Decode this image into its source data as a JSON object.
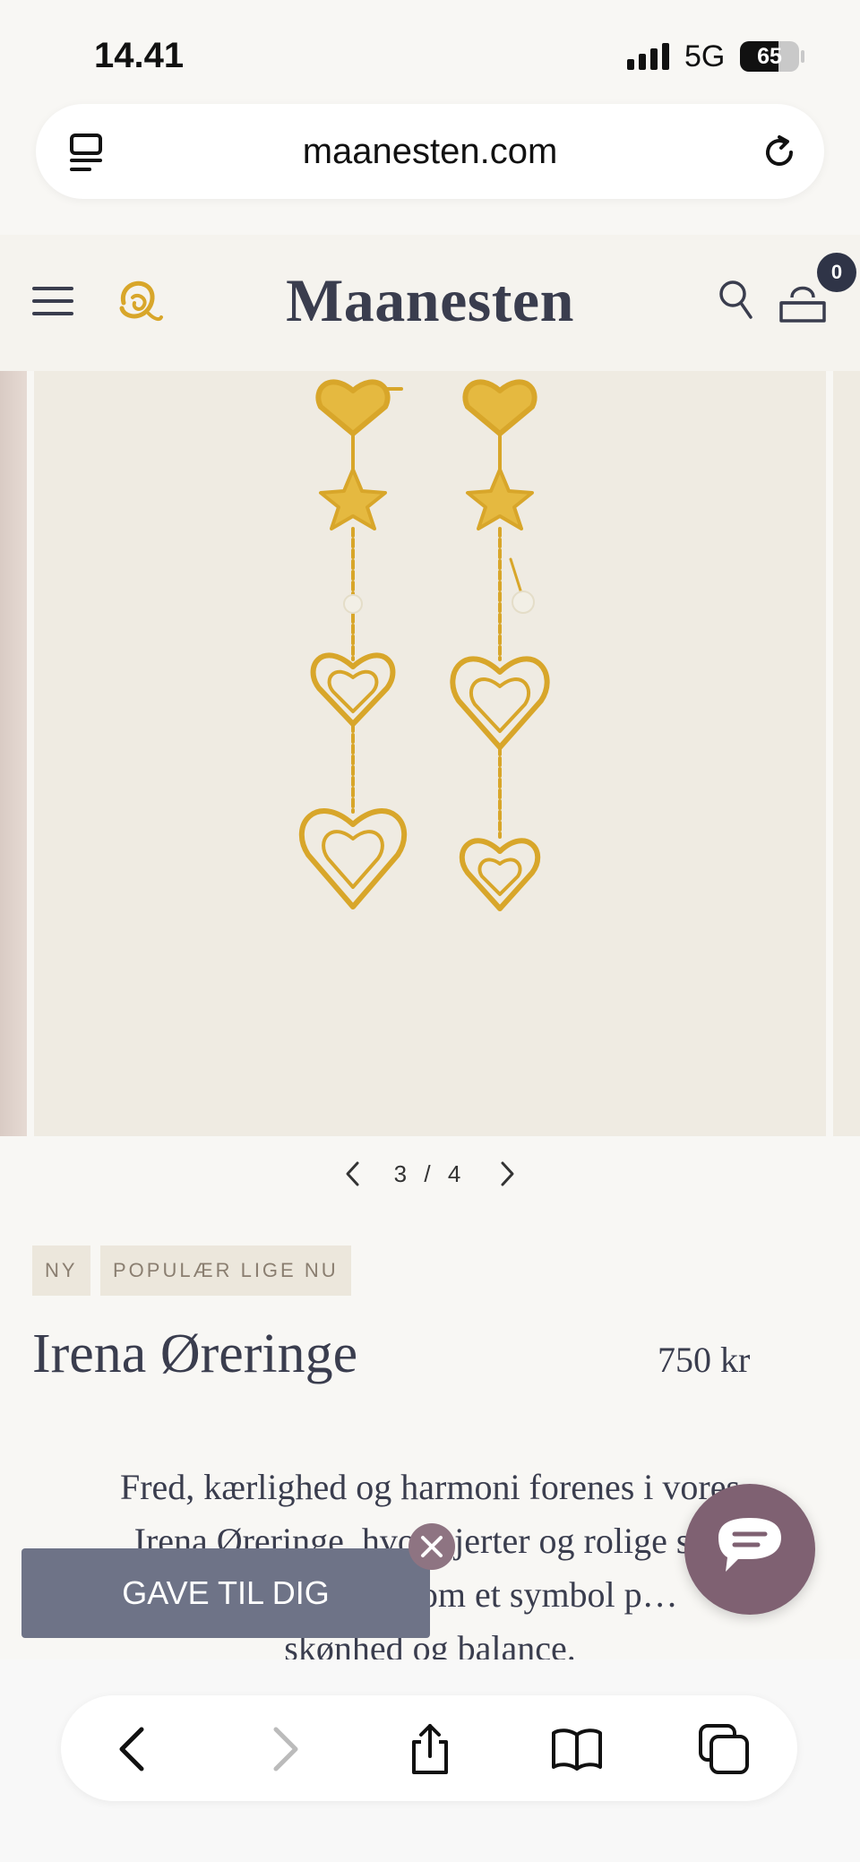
{
  "status_bar": {
    "time": "14.41",
    "network": "5G",
    "battery": "65",
    "battery_level": 0.65
  },
  "browser": {
    "url": "maanesten.com"
  },
  "site": {
    "brand": "Maanesten",
    "cart_count": "0"
  },
  "gallery": {
    "current": "3",
    "separator": "/",
    "total": "4"
  },
  "product": {
    "tags": [
      "NY",
      "POPULÆR LIGE NU"
    ],
    "title": "Irena Øreringe",
    "price": "750 kr",
    "description_lines": [
      "Fred, kærlighed og harmoni forenes i vores",
      "Irena Øreringe, hvor hjerter og rolige s…",
      "— som et symbol p…",
      "skønhed og balance."
    ]
  },
  "gift_banner": {
    "label": "GAVE TIL DIG"
  },
  "colors": {
    "header_bg": "#f5f3ee",
    "brand": "#3a3d4e",
    "gift": "#6e7387",
    "chat": "#7f6172",
    "gold": "#d8a62a"
  }
}
